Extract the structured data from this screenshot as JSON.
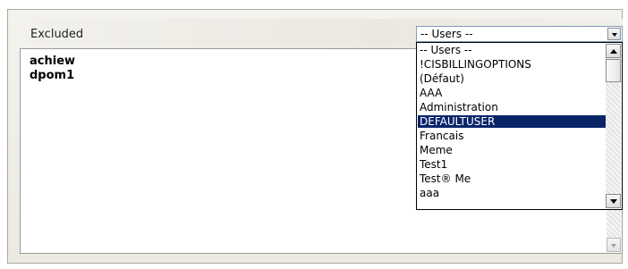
{
  "panel": {
    "title": "Excluded"
  },
  "user_select": {
    "value": "-- Users --",
    "options": [
      "-- Users --",
      "!CISBILLINGOPTIONS",
      "(Défaut)",
      "AAA",
      "Administration",
      "DEFAULTUSER",
      "Francais",
      "Meme",
      "Test1",
      "Test® Me",
      "aaa"
    ],
    "highlighted": "DEFAULTUSER"
  },
  "excluded_list": {
    "items": [
      "achiew",
      "dpom1"
    ]
  },
  "colors": {
    "highlight_bg": "#0a246a",
    "highlight_fg": "#ffffff"
  }
}
